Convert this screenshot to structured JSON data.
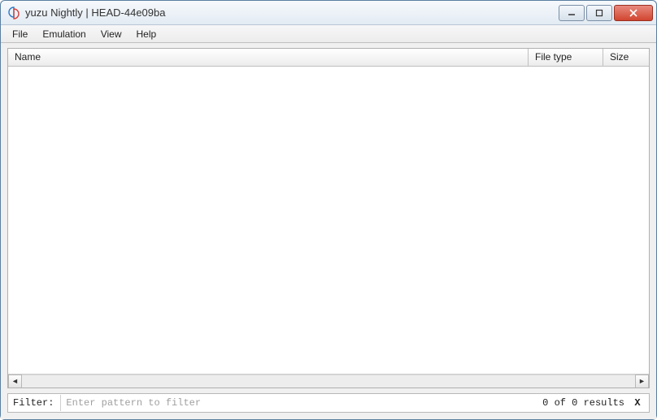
{
  "title": "yuzu Nightly | HEAD-44e09ba",
  "menu": {
    "file": "File",
    "emulation": "Emulation",
    "view": "View",
    "help": "Help"
  },
  "table": {
    "headers": {
      "name": "Name",
      "file_type": "File type",
      "size": "Size"
    }
  },
  "filter": {
    "label": "Filter:",
    "placeholder": "Enter pattern to filter",
    "results": "0 of 0 results",
    "clear": "X"
  }
}
